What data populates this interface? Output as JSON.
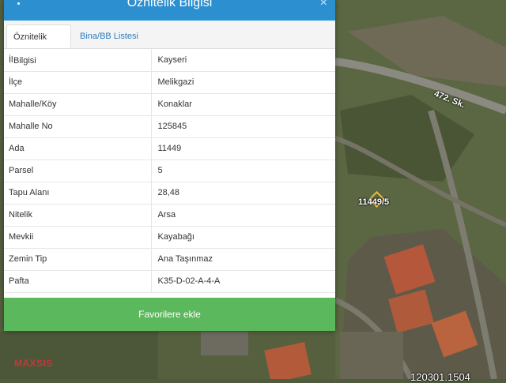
{
  "panel": {
    "title": "Öznitelik Bilgisi",
    "close_label": "×"
  },
  "tabs": [
    {
      "label": "Öznitelik Bilgisi",
      "active": true
    },
    {
      "label": "Bina/BB Listesi",
      "active": false
    }
  ],
  "attributes": [
    {
      "key": "İl",
      "value": "Kayseri"
    },
    {
      "key": "İlçe",
      "value": "Melikgazi"
    },
    {
      "key": "Mahalle/Köy",
      "value": "Konaklar"
    },
    {
      "key": "Mahalle No",
      "value": "125845"
    },
    {
      "key": "Ada",
      "value": "11449"
    },
    {
      "key": "Parsel",
      "value": "5"
    },
    {
      "key": "Tapu Alanı",
      "value": "28,48"
    },
    {
      "key": "Nitelik",
      "value": "Arsa"
    },
    {
      "key": "Mevkii",
      "value": "Kayabağı"
    },
    {
      "key": "Zemin Tip",
      "value": "Ana Taşınmaz"
    },
    {
      "key": "Pafta",
      "value": "K35-D-02-A-4-A"
    }
  ],
  "favorite_button": "Favorilere ekle",
  "map": {
    "street_label": "472. Sk.",
    "parcel_label": "11449/5",
    "coordinate_text": "120301.1504",
    "watermark": "MAXSIS"
  },
  "colors": {
    "header": "#2b8fd0",
    "button": "#5cb85c",
    "link": "#2b7bbf"
  },
  "icons": {
    "menu": "kebab-menu-icon",
    "close": "close-icon",
    "marker": "parcel-marker-icon"
  }
}
